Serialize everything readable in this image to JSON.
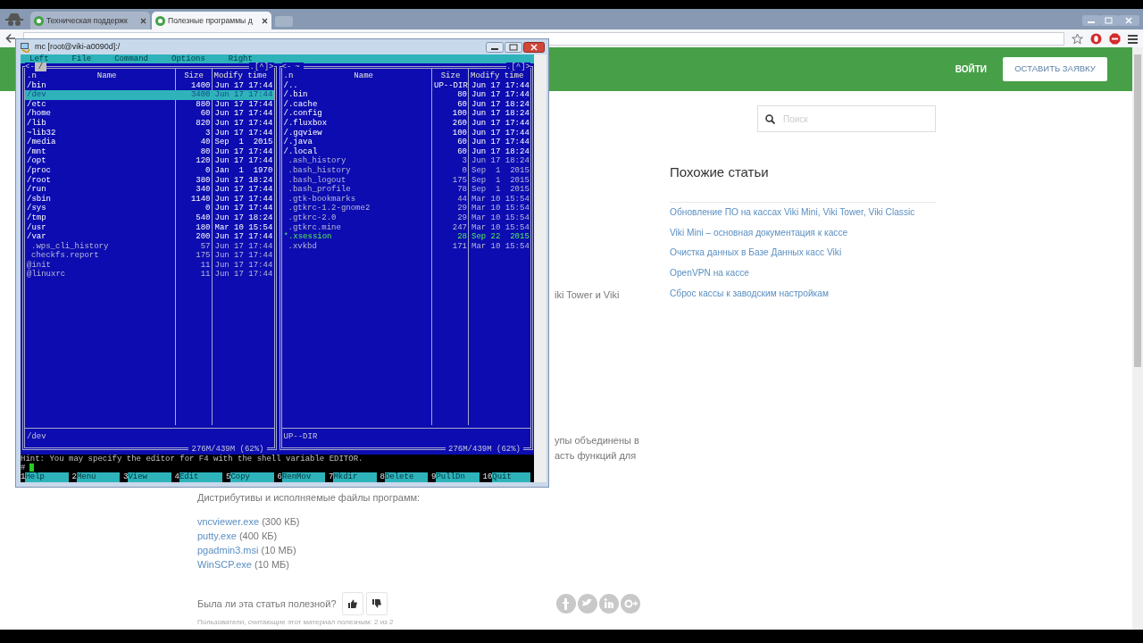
{
  "browser": {
    "tabs": [
      {
        "title": "Техническая поддержк",
        "selected": false
      },
      {
        "title": "Полезные программы д",
        "selected": true
      }
    ]
  },
  "site": {
    "header": {
      "login": "ВОЙТИ",
      "cta": "ОСТАВИТЬ ЗАЯВКУ"
    },
    "search": {
      "placeholder": "Поиск"
    },
    "related": {
      "title": "Похожие статьи",
      "links": [
        "Обновление ПО на кассах Viki Mini, Viki Tower, Viki Classic",
        "Viki Mini – основная документация к кассе",
        "Очистка данных в Базе Данных касс Viki",
        "OpenVPN на кассе",
        "Сброс кассы к заводским настройкам"
      ]
    },
    "article": {
      "text_fragments": [
        {
          "lines": [
            "iki Tower и Viki"
          ]
        },
        {
          "lines": [
            "упы объединены в",
            "асть функций для"
          ]
        }
      ],
      "downloads_title": "Дистрибутивы и исполняемые файлы программ:",
      "downloads": [
        {
          "name": "vncviewer.exe",
          "size": "(300 КБ)"
        },
        {
          "name": "putty.exe",
          "size": "(400 КБ)"
        },
        {
          "name": "pgadmin3.msi",
          "size": "(10 МБ)"
        },
        {
          "name": "WinSCP.exe",
          "size": "(10 МБ)"
        }
      ],
      "feedback": {
        "question": "Была ли эта статья полезной?",
        "stats": "Пользователи, считающие этот материал полезным: 2 из 2"
      }
    }
  },
  "mc": {
    "title": "mc [root@viki-a0090d]:/",
    "menu": [
      "Left",
      "File",
      "Command",
      "Options",
      "Right"
    ],
    "panels": [
      {
        "path": "/",
        "active": true,
        "corner_left": "<-",
        "corner_right": ".[^]>",
        "columns": [
          ".n",
          "Name",
          "Size",
          "Modify time"
        ],
        "status": "/dev",
        "free": "276M/439M (62%)",
        "rows": [
          {
            "name": "/bin",
            "size": "1400",
            "time": "Jun 17 17:44",
            "kind": "dir",
            "selected": false
          },
          {
            "name": "/dev",
            "size": "3400",
            "time": "Jun 17 17:44",
            "kind": "dir",
            "selected": true
          },
          {
            "name": "/etc",
            "size": "880",
            "time": "Jun 17 17:44",
            "kind": "dir",
            "selected": false
          },
          {
            "name": "/home",
            "size": "60",
            "time": "Jun 17 17:44",
            "kind": "dir",
            "selected": false
          },
          {
            "name": "/lib",
            "size": "820",
            "time": "Jun 17 17:44",
            "kind": "dir",
            "selected": false
          },
          {
            "name": "~lib32",
            "size": "3",
            "time": "Jun 17 17:44",
            "kind": "dir",
            "selected": false
          },
          {
            "name": "/media",
            "size": "40",
            "time": "Sep  1  2015",
            "kind": "dir",
            "selected": false
          },
          {
            "name": "/mnt",
            "size": "80",
            "time": "Jun 17 17:44",
            "kind": "dir",
            "selected": false
          },
          {
            "name": "/opt",
            "size": "120",
            "time": "Jun 17 17:44",
            "kind": "dir",
            "selected": false
          },
          {
            "name": "/proc",
            "size": "0",
            "time": "Jan  1  1970",
            "kind": "dir",
            "selected": false
          },
          {
            "name": "/root",
            "size": "380",
            "time": "Jun 17 18:24",
            "kind": "dir",
            "selected": false
          },
          {
            "name": "/run",
            "size": "340",
            "time": "Jun 17 17:44",
            "kind": "dir",
            "selected": false
          },
          {
            "name": "/sbin",
            "size": "1140",
            "time": "Jun 17 17:44",
            "kind": "dir",
            "selected": false
          },
          {
            "name": "/sys",
            "size": "0",
            "time": "Jun 17 17:44",
            "kind": "dir",
            "selected": false
          },
          {
            "name": "/tmp",
            "size": "540",
            "time": "Jun 17 18:24",
            "kind": "dir",
            "selected": false
          },
          {
            "name": "/usr",
            "size": "180",
            "time": "Mar 10 15:54",
            "kind": "dir",
            "selected": false
          },
          {
            "name": "/var",
            "size": "200",
            "time": "Jun 17 17:44",
            "kind": "dir",
            "selected": false
          },
          {
            "name": ".wps_cli_history",
            "size": "57",
            "time": "Jun 17 17:44",
            "kind": "file",
            "selected": false
          },
          {
            "name": "checkfs.report",
            "size": "175",
            "time": "Jun 17 17:44",
            "kind": "file",
            "selected": false
          },
          {
            "name": "@init",
            "size": "11",
            "time": "Jun 17 17:44",
            "kind": "link",
            "selected": false
          },
          {
            "name": "@linuxrc",
            "size": "11",
            "time": "Jun 17 17:44",
            "kind": "link",
            "selected": false
          }
        ]
      },
      {
        "path": "~",
        "active": false,
        "corner_left": "<-",
        "corner_right": ".[^]>",
        "columns": [
          ".n",
          "Name",
          "Size",
          "Modify time"
        ],
        "status": "UP--DIR",
        "free": "276M/439M (62%)",
        "rows": [
          {
            "name": "/..",
            "size": "UP--DIR",
            "time": "Jun 17 17:44",
            "kind": "dir",
            "selected": false
          },
          {
            "name": "/.bin",
            "size": "80",
            "time": "Jun 17 17:44",
            "kind": "dir",
            "selected": false
          },
          {
            "name": "/.cache",
            "size": "60",
            "time": "Jun 17 18:24",
            "kind": "dir",
            "selected": false
          },
          {
            "name": "/.config",
            "size": "100",
            "time": "Jun 17 18:24",
            "kind": "dir",
            "selected": false
          },
          {
            "name": "/.fluxbox",
            "size": "260",
            "time": "Jun 17 17:44",
            "kind": "dir",
            "selected": false
          },
          {
            "name": "/.gqview",
            "size": "100",
            "time": "Jun 17 17:44",
            "kind": "dir",
            "selected": false
          },
          {
            "name": "/.java",
            "size": "60",
            "time": "Jun 17 17:44",
            "kind": "dir",
            "selected": false
          },
          {
            "name": "/.local",
            "size": "60",
            "time": "Jun 17 18:24",
            "kind": "dir",
            "selected": false
          },
          {
            "name": ".ash_history",
            "size": "3",
            "time": "Jun 17 18:24",
            "kind": "file",
            "selected": false
          },
          {
            "name": ".bash_history",
            "size": "0",
            "time": "Sep  1  2015",
            "kind": "file",
            "selected": false
          },
          {
            "name": ".bash_logout",
            "size": "175",
            "time": "Sep  1  2015",
            "kind": "file",
            "selected": false
          },
          {
            "name": ".bash_profile",
            "size": "78",
            "time": "Sep  1  2015",
            "kind": "file",
            "selected": false
          },
          {
            "name": ".gtk-bookmarks",
            "size": "44",
            "time": "Mar 10 15:54",
            "kind": "file",
            "selected": false
          },
          {
            "name": ".gtkrc-1.2-gnome2",
            "size": "29",
            "time": "Mar 10 15:54",
            "kind": "file",
            "selected": false
          },
          {
            "name": ".gtkrc-2.0",
            "size": "29",
            "time": "Mar 10 15:54",
            "kind": "file",
            "selected": false
          },
          {
            "name": ".gtkrc.mine",
            "size": "247",
            "time": "Mar 10 15:54",
            "kind": "file",
            "selected": false
          },
          {
            "name": "*.xsession",
            "size": "28",
            "time": "Sep 22  2015",
            "kind": "exec",
            "selected": false
          },
          {
            "name": ".xvkbd",
            "size": "171",
            "time": "Mar 10 15:54",
            "kind": "file",
            "selected": false
          }
        ]
      }
    ],
    "hint": "Hint: You may specify the editor for F4 with the shell variable EDITOR.",
    "prompt": "#",
    "keys": [
      {
        "num": "1",
        "label": "Help"
      },
      {
        "num": "2",
        "label": "Menu"
      },
      {
        "num": "3",
        "label": "View"
      },
      {
        "num": "4",
        "label": "Edit"
      },
      {
        "num": "5",
        "label": "Copy"
      },
      {
        "num": "6",
        "label": "RenMov"
      },
      {
        "num": "7",
        "label": "Mkdir"
      },
      {
        "num": "8",
        "label": "Delete"
      },
      {
        "num": "9",
        "label": "PullDn"
      },
      {
        "num": "10",
        "label": "Quit"
      }
    ]
  }
}
